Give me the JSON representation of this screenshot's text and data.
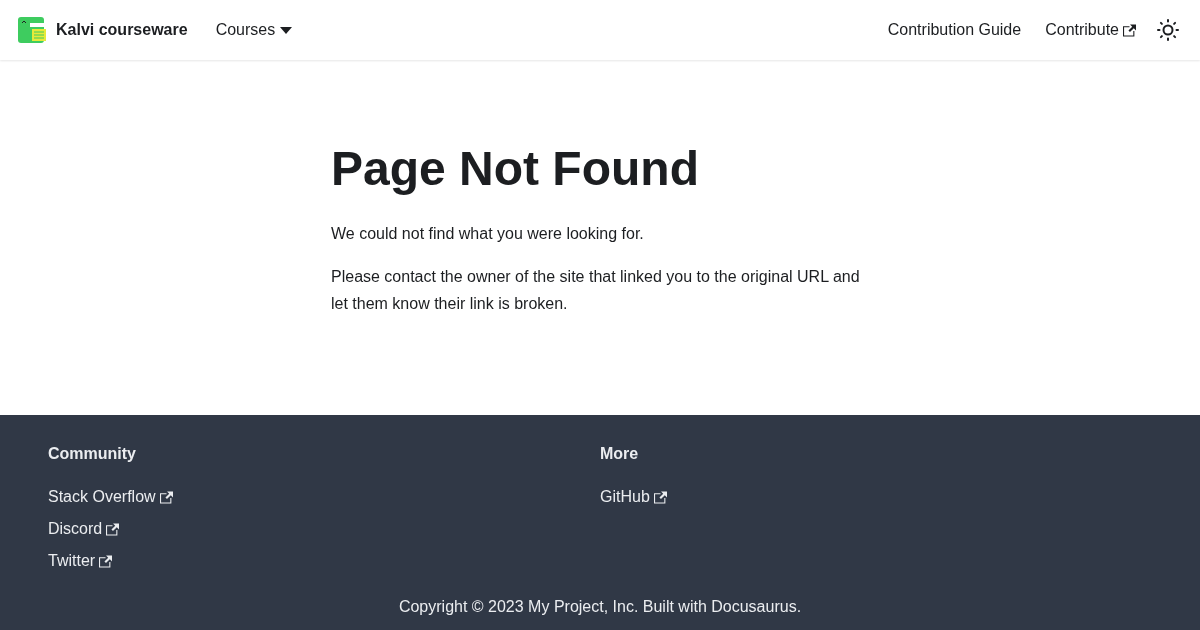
{
  "navbar": {
    "title": "Kalvi courseware",
    "items": [
      {
        "label": "Courses",
        "kind": "dropdown"
      }
    ],
    "right_items": [
      {
        "label": "Contribution Guide",
        "external": false
      },
      {
        "label": "Contribute",
        "external": true
      }
    ]
  },
  "main": {
    "heading": "Page Not Found",
    "paragraphs": [
      "We could not find what you were looking for.",
      "Please contact the owner of the site that linked you to the original URL and let them know their link is broken."
    ]
  },
  "footer": {
    "columns": [
      {
        "title": "Community",
        "links": [
          {
            "label": "Stack Overflow",
            "external": true
          },
          {
            "label": "Discord",
            "external": true
          },
          {
            "label": "Twitter",
            "external": true
          }
        ]
      },
      {
        "title": "More",
        "links": [
          {
            "label": "GitHub",
            "external": true
          }
        ]
      }
    ],
    "copyright": "Copyright © 2023 My Project, Inc. Built with Docusaurus."
  }
}
